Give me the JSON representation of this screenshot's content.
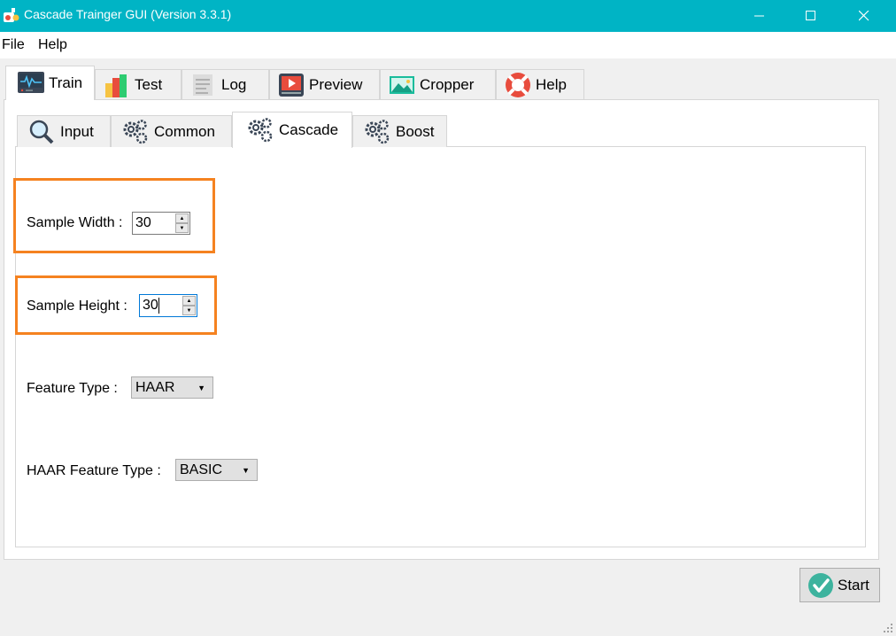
{
  "window": {
    "title": "Cascade Trainger GUI (Version 3.3.1)"
  },
  "menu": {
    "file": "File",
    "help": "Help"
  },
  "outer_tabs": [
    {
      "label": "Train",
      "icon": "monitor-icon",
      "active": true
    },
    {
      "label": "Test",
      "icon": "chart-icon"
    },
    {
      "label": "Log",
      "icon": "log-icon"
    },
    {
      "label": "Preview",
      "icon": "play-icon"
    },
    {
      "label": "Cropper",
      "icon": "image-icon"
    },
    {
      "label": "Help",
      "icon": "lifebuoy-icon"
    }
  ],
  "inner_tabs": [
    {
      "label": "Input",
      "icon": "magnifier-icon"
    },
    {
      "label": "Common",
      "icon": "gears-icon"
    },
    {
      "label": "Cascade",
      "icon": "gears-icon",
      "active": true
    },
    {
      "label": "Boost",
      "icon": "gears-icon"
    }
  ],
  "cascade": {
    "sample_width_label": "Sample Width :",
    "sample_width_value": "30",
    "sample_height_label": "Sample Height :",
    "sample_height_value": "30",
    "feature_type_label": "Feature Type :",
    "feature_type_value": "HAAR",
    "haar_feature_type_label": "HAAR Feature Type :",
    "haar_feature_type_value": "BASIC"
  },
  "actions": {
    "start": "Start"
  },
  "colors": {
    "titlebar": "#00b4c5",
    "highlight": "#f58220",
    "start_check": "#3db39e"
  }
}
